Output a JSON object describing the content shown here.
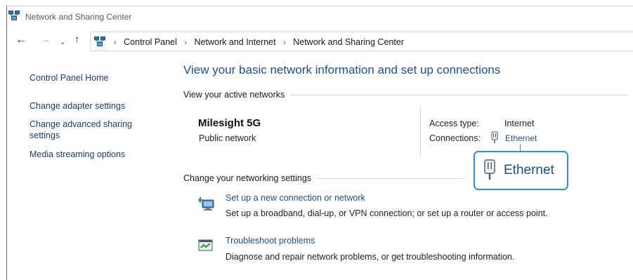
{
  "window": {
    "title": "Network and Sharing Center"
  },
  "nav": {
    "back_glyph": "←",
    "forward_glyph": "→",
    "recent_glyph": "⌄",
    "up_glyph": "↑",
    "breadcrumbs": [
      "Control Panel",
      "Network and Internet",
      "Network and Sharing Center"
    ],
    "separator": "›"
  },
  "sidebar": {
    "items": [
      {
        "label": "Control Panel Home"
      },
      {
        "label": "Change adapter settings"
      },
      {
        "label": "Change advanced sharing settings"
      },
      {
        "label": "Media streaming options"
      }
    ]
  },
  "main": {
    "title": "View your basic network information and set up connections",
    "active_networks_heading": "View your active networks",
    "network": {
      "name": "Milesight 5G",
      "type": "Public network",
      "access_type_label": "Access type:",
      "access_type_value": "Internet",
      "connections_label": "Connections:",
      "connection_name": "Ethernet"
    },
    "callout_label": "Ethernet",
    "change_heading": "Change your networking settings",
    "tasks": [
      {
        "icon": "new-connection-icon",
        "link": "Set up a new connection or network",
        "desc": "Set up a broadband, dial-up, or VPN connection; or set up a router or access point."
      },
      {
        "icon": "troubleshoot-icon",
        "link": "Troubleshoot problems",
        "desc": "Diagnose and repair network problems, or get troubleshooting information."
      }
    ]
  },
  "colors": {
    "link": "#1e4e8c",
    "title": "#1e4e8c",
    "callout_border": "#2f8fd4",
    "text": "#1a1a1a"
  }
}
